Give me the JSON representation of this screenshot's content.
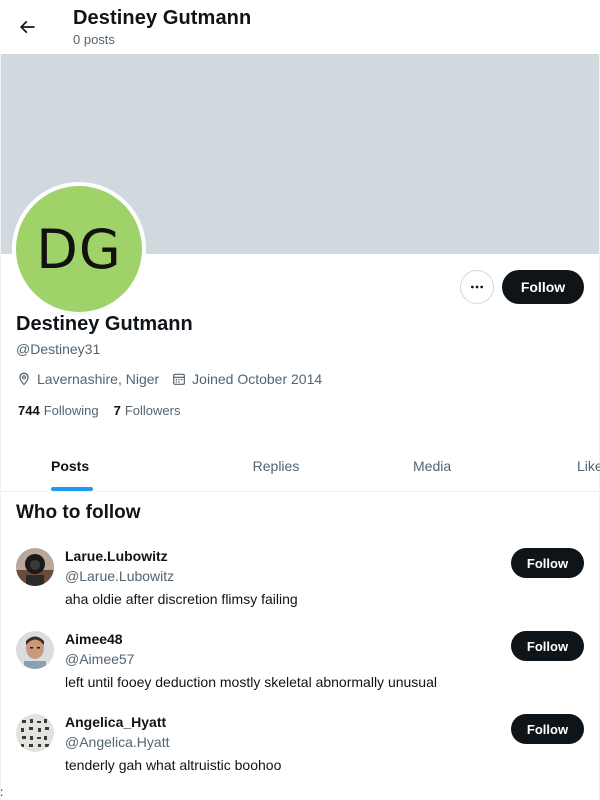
{
  "header": {
    "title": "Destiney Gutmann",
    "subtitle": "0 posts"
  },
  "profile": {
    "avatar_initials": "DG",
    "avatar_color": "#a0d26a",
    "banner_color": "#cfd9de",
    "name": "Destiney Gutmann",
    "handle": "@Destiney31",
    "location": "Lavernashire, Niger",
    "joined": "Joined October 2014",
    "following_count": "744",
    "following_label": "Following",
    "followers_count": "7",
    "followers_label": "Followers",
    "follow_label": "Follow"
  },
  "tabs": [
    {
      "label": "Posts",
      "active": true
    },
    {
      "label": "Replies",
      "active": false
    },
    {
      "label": "Media",
      "active": false
    },
    {
      "label": "Likes",
      "active": false
    }
  ],
  "who_to_follow": {
    "title": "Who to follow",
    "items": [
      {
        "name": "Larue.Lubowitz",
        "handle": "@Larue.Lubowitz",
        "bio": "aha oldie after discretion flimsy failing",
        "button": "Follow"
      },
      {
        "name": "Aimee48",
        "handle": "@Aimee57",
        "bio": "left until fooey deduction mostly skeletal abnormally unusual",
        "button": "Follow"
      },
      {
        "name": "Angelica_Hyatt",
        "handle": "@Angelica.Hyatt",
        "bio": "tenderly gah what altruistic boohoo",
        "button": "Follow"
      }
    ]
  },
  "accent_color": "#1d9bf0",
  "stray_text": ":"
}
